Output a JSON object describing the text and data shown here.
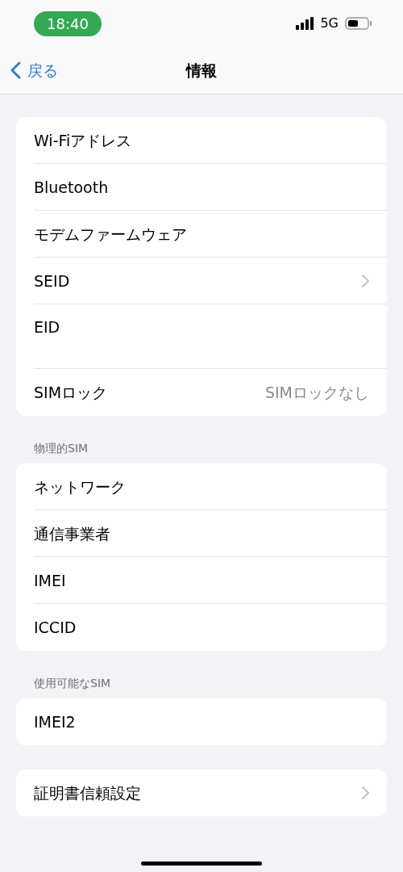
{
  "status_bar": {
    "time": "18:40",
    "network": "5G"
  },
  "nav": {
    "back": "戻る",
    "title": "情報"
  },
  "sections": [
    {
      "rows": [
        {
          "label": "Wi-Fiアドレス",
          "chevron": false
        },
        {
          "label": "Bluetooth",
          "chevron": false
        },
        {
          "label": "モデムファームウェア",
          "chevron": false
        },
        {
          "label": "SEID",
          "chevron": true
        },
        {
          "label": "EID",
          "chevron": false,
          "kind": "tall"
        },
        {
          "label": "SIMロック",
          "value": "SIMロックなし",
          "chevron": false
        }
      ]
    },
    {
      "header": "物理的SIM",
      "rows": [
        {
          "label": "ネットワーク",
          "chevron": false
        },
        {
          "label": "通信事業者",
          "chevron": false
        },
        {
          "label": "IMEI",
          "chevron": false
        },
        {
          "label": "ICCID",
          "chevron": false
        }
      ]
    },
    {
      "header": "使用可能なSIM",
      "rows": [
        {
          "label": "IMEI2",
          "chevron": false
        }
      ]
    },
    {
      "rows": [
        {
          "label": "証明書信頼設定",
          "chevron": true
        }
      ]
    }
  ]
}
